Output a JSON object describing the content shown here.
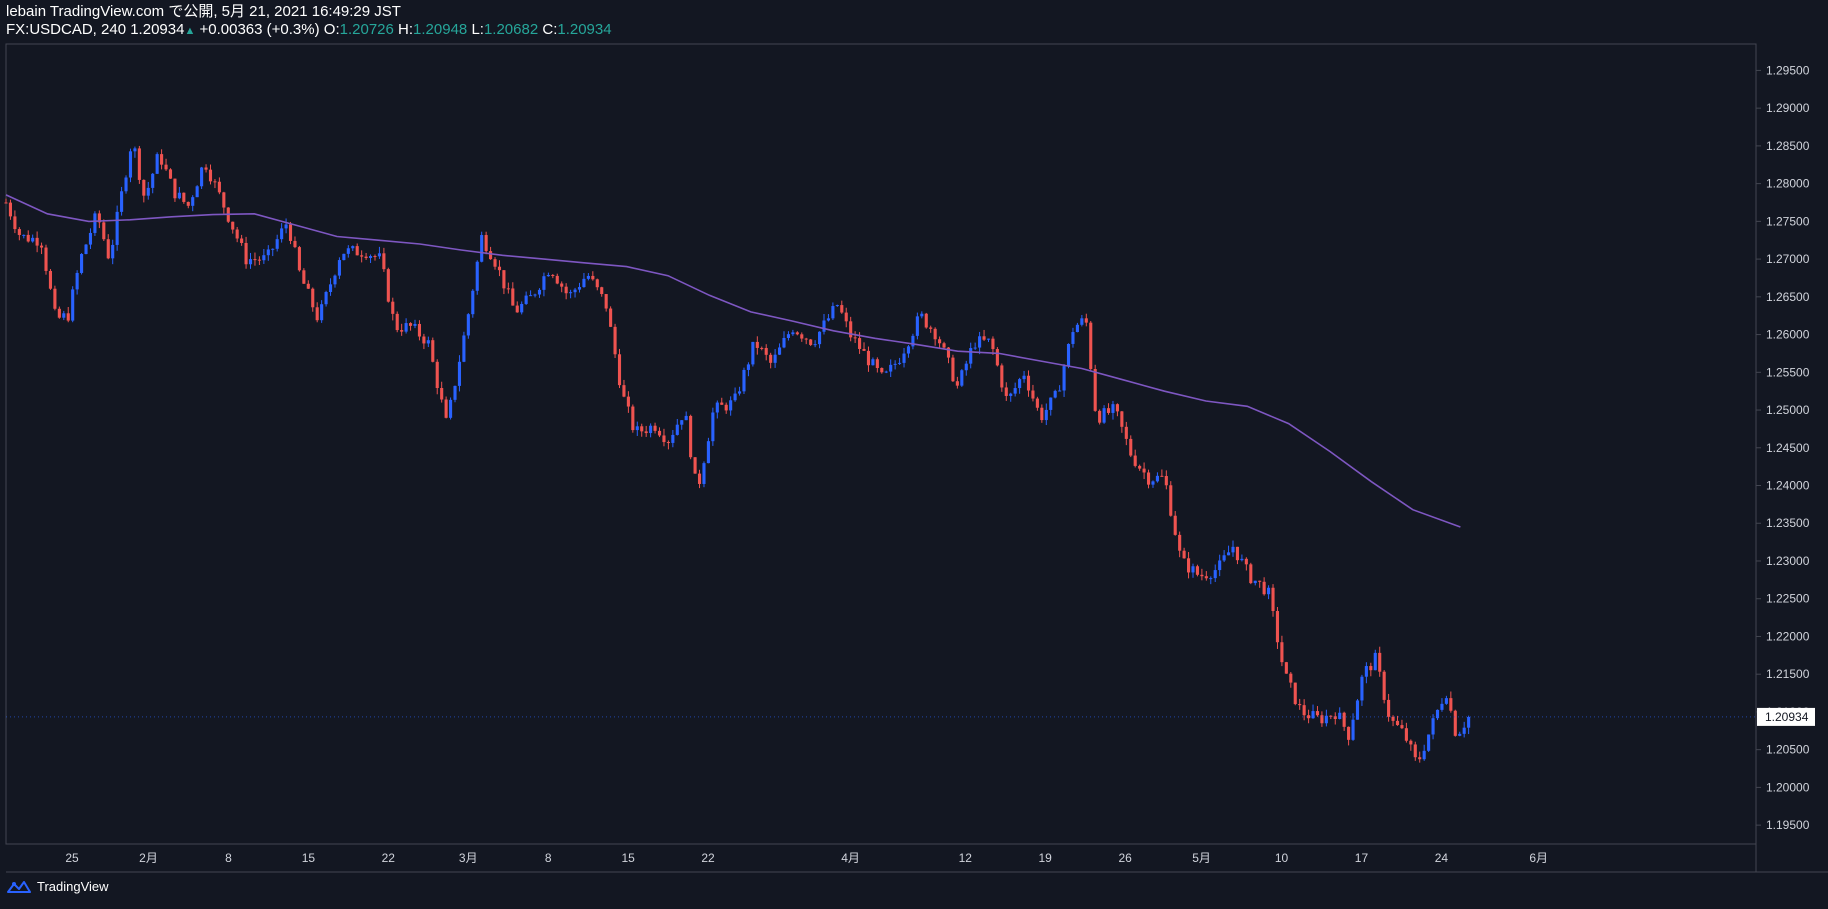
{
  "header": {
    "line1": "lebain TradingView.com で公開, 5月 21, 2021 16:49:29 JST",
    "symbol": "FX:USDCAD, 240",
    "last": "1.20934",
    "change": "+0.00363 (+0.3%)",
    "o_label": "O:",
    "o_value": "1.20726",
    "h_label": "H:",
    "h_value": "1.20948",
    "l_label": "L:",
    "l_value": "1.20682",
    "c_label": "C:",
    "c_value": "1.20934"
  },
  "footer": {
    "brand": "TradingView",
    "logo_icon": "tradingview-logo-icon"
  },
  "colors": {
    "background": "#131722",
    "up": "#2962ff",
    "down": "#ef5350",
    "ma": "#7e57c2",
    "axis_text": "#d1d4dc",
    "border": "#434651",
    "last_price_label": "#ffffff"
  },
  "chart_data": {
    "type": "candlestick",
    "symbol": "FX:USDCAD",
    "timeframe": "240",
    "ylim": [
      1.1925,
      1.2985
    ],
    "y_ticks": [
      "1.19500",
      "1.20000",
      "1.20500",
      "1.21000",
      "1.21500",
      "1.22000",
      "1.22500",
      "1.23000",
      "1.23500",
      "1.24000",
      "1.24500",
      "1.25000",
      "1.25500",
      "1.26000",
      "1.26500",
      "1.27000",
      "1.27500",
      "1.28000",
      "1.28500",
      "1.29000",
      "1.29500"
    ],
    "x_ticks": [
      "25",
      "2月",
      "8",
      "15",
      "22",
      "3月",
      "8",
      "15",
      "22",
      "4月",
      "12",
      "19",
      "26",
      "5月",
      "10",
      "17",
      "24",
      "6月"
    ],
    "last_price": "1.20934",
    "price_path": [
      {
        "x": 0.0,
        "y": 1.2775
      },
      {
        "x": 0.7,
        "y": 1.273
      },
      {
        "x": 1.7,
        "y": 1.2725
      },
      {
        "x": 2.4,
        "y": 1.262
      },
      {
        "x": 3.0,
        "y": 1.2625
      },
      {
        "x": 3.6,
        "y": 1.27
      },
      {
        "x": 4.4,
        "y": 1.276
      },
      {
        "x": 5.0,
        "y": 1.27
      },
      {
        "x": 6.1,
        "y": 1.286
      },
      {
        "x": 6.7,
        "y": 1.278
      },
      {
        "x": 7.4,
        "y": 1.284
      },
      {
        "x": 8.1,
        "y": 1.279
      },
      {
        "x": 8.8,
        "y": 1.277
      },
      {
        "x": 9.6,
        "y": 1.283
      },
      {
        "x": 10.7,
        "y": 1.276
      },
      {
        "x": 11.6,
        "y": 1.27
      },
      {
        "x": 12.6,
        "y": 1.27
      },
      {
        "x": 13.6,
        "y": 1.275
      },
      {
        "x": 14.2,
        "y": 1.268
      },
      {
        "x": 15.1,
        "y": 1.262
      },
      {
        "x": 16.2,
        "y": 1.271
      },
      {
        "x": 17.4,
        "y": 1.271
      },
      {
        "x": 18.1,
        "y": 1.27
      },
      {
        "x": 18.8,
        "y": 1.261
      },
      {
        "x": 19.6,
        "y": 1.261
      },
      {
        "x": 20.4,
        "y": 1.259
      },
      {
        "x": 21.3,
        "y": 1.248
      },
      {
        "x": 22.3,
        "y": 1.262
      },
      {
        "x": 23.0,
        "y": 1.273
      },
      {
        "x": 23.6,
        "y": 1.27
      },
      {
        "x": 24.6,
        "y": 1.263
      },
      {
        "x": 25.4,
        "y": 1.265
      },
      {
        "x": 26.3,
        "y": 1.269
      },
      {
        "x": 27.2,
        "y": 1.265
      },
      {
        "x": 28.1,
        "y": 1.268
      },
      {
        "x": 29.0,
        "y": 1.264
      },
      {
        "x": 29.8,
        "y": 1.252
      },
      {
        "x": 30.4,
        "y": 1.247
      },
      {
        "x": 31.4,
        "y": 1.248
      },
      {
        "x": 32.0,
        "y": 1.246
      },
      {
        "x": 32.8,
        "y": 1.25
      },
      {
        "x": 33.4,
        "y": 1.239
      },
      {
        "x": 34.2,
        "y": 1.25
      },
      {
        "x": 35.2,
        "y": 1.251
      },
      {
        "x": 36.2,
        "y": 1.259
      },
      {
        "x": 37.0,
        "y": 1.256
      },
      {
        "x": 38.0,
        "y": 1.261
      },
      {
        "x": 39.0,
        "y": 1.259
      },
      {
        "x": 40.2,
        "y": 1.264
      },
      {
        "x": 40.8,
        "y": 1.26
      },
      {
        "x": 41.6,
        "y": 1.257
      },
      {
        "x": 42.4,
        "y": 1.254
      },
      {
        "x": 43.2,
        "y": 1.257
      },
      {
        "x": 44.2,
        "y": 1.2625
      },
      {
        "x": 45.0,
        "y": 1.26
      },
      {
        "x": 46.0,
        "y": 1.253
      },
      {
        "x": 46.8,
        "y": 1.259
      },
      {
        "x": 47.6,
        "y": 1.259
      },
      {
        "x": 48.4,
        "y": 1.251
      },
      {
        "x": 49.2,
        "y": 1.255
      },
      {
        "x": 50.0,
        "y": 1.249
      },
      {
        "x": 50.8,
        "y": 1.252
      },
      {
        "x": 51.6,
        "y": 1.261
      },
      {
        "x": 52.2,
        "y": 1.262
      },
      {
        "x": 52.7,
        "y": 1.249
      },
      {
        "x": 53.6,
        "y": 1.25
      },
      {
        "x": 54.4,
        "y": 1.244
      },
      {
        "x": 55.2,
        "y": 1.241
      },
      {
        "x": 56.0,
        "y": 1.241
      },
      {
        "x": 56.8,
        "y": 1.23
      },
      {
        "x": 57.7,
        "y": 1.228
      },
      {
        "x": 58.6,
        "y": 1.229
      },
      {
        "x": 59.3,
        "y": 1.232
      },
      {
        "x": 60.1,
        "y": 1.228
      },
      {
        "x": 61.0,
        "y": 1.226
      },
      {
        "x": 61.8,
        "y": 1.215
      },
      {
        "x": 62.6,
        "y": 1.21
      },
      {
        "x": 63.5,
        "y": 1.209
      },
      {
        "x": 64.3,
        "y": 1.21
      },
      {
        "x": 64.9,
        "y": 1.207
      },
      {
        "x": 65.6,
        "y": 1.215
      },
      {
        "x": 66.2,
        "y": 1.217
      },
      {
        "x": 66.9,
        "y": 1.209
      },
      {
        "x": 67.6,
        "y": 1.207
      },
      {
        "x": 68.2,
        "y": 1.203
      },
      {
        "x": 68.9,
        "y": 1.208
      },
      {
        "x": 69.6,
        "y": 1.213
      },
      {
        "x": 70.1,
        "y": 1.207
      },
      {
        "x": 70.7,
        "y": 1.2093
      }
    ],
    "ma_line": [
      {
        "x": 0,
        "y": 1.2785
      },
      {
        "x": 2,
        "y": 1.276
      },
      {
        "x": 4,
        "y": 1.275
      },
      {
        "x": 6,
        "y": 1.2752
      },
      {
        "x": 8,
        "y": 1.2756
      },
      {
        "x": 10,
        "y": 1.2759
      },
      {
        "x": 12,
        "y": 1.276
      },
      {
        "x": 14,
        "y": 1.2745
      },
      {
        "x": 16,
        "y": 1.273
      },
      {
        "x": 18,
        "y": 1.2725
      },
      {
        "x": 20,
        "y": 1.272
      },
      {
        "x": 22,
        "y": 1.2712
      },
      {
        "x": 24,
        "y": 1.2705
      },
      {
        "x": 26,
        "y": 1.27
      },
      {
        "x": 28,
        "y": 1.2695
      },
      {
        "x": 30,
        "y": 1.269
      },
      {
        "x": 32,
        "y": 1.2678
      },
      {
        "x": 34,
        "y": 1.2652
      },
      {
        "x": 36,
        "y": 1.263
      },
      {
        "x": 38,
        "y": 1.2618
      },
      {
        "x": 40,
        "y": 1.2605
      },
      {
        "x": 42,
        "y": 1.2595
      },
      {
        "x": 44,
        "y": 1.2587
      },
      {
        "x": 46,
        "y": 1.2578
      },
      {
        "x": 48,
        "y": 1.2575
      },
      {
        "x": 50,
        "y": 1.2565
      },
      {
        "x": 52,
        "y": 1.2555
      },
      {
        "x": 54,
        "y": 1.254
      },
      {
        "x": 56,
        "y": 1.2525
      },
      {
        "x": 58,
        "y": 1.2512
      },
      {
        "x": 60,
        "y": 1.2505
      },
      {
        "x": 62,
        "y": 1.2482
      },
      {
        "x": 64,
        "y": 1.2445
      },
      {
        "x": 66,
        "y": 1.2405
      },
      {
        "x": 68,
        "y": 1.2368
      },
      {
        "x": 70.3,
        "y": 1.2345
      }
    ]
  }
}
